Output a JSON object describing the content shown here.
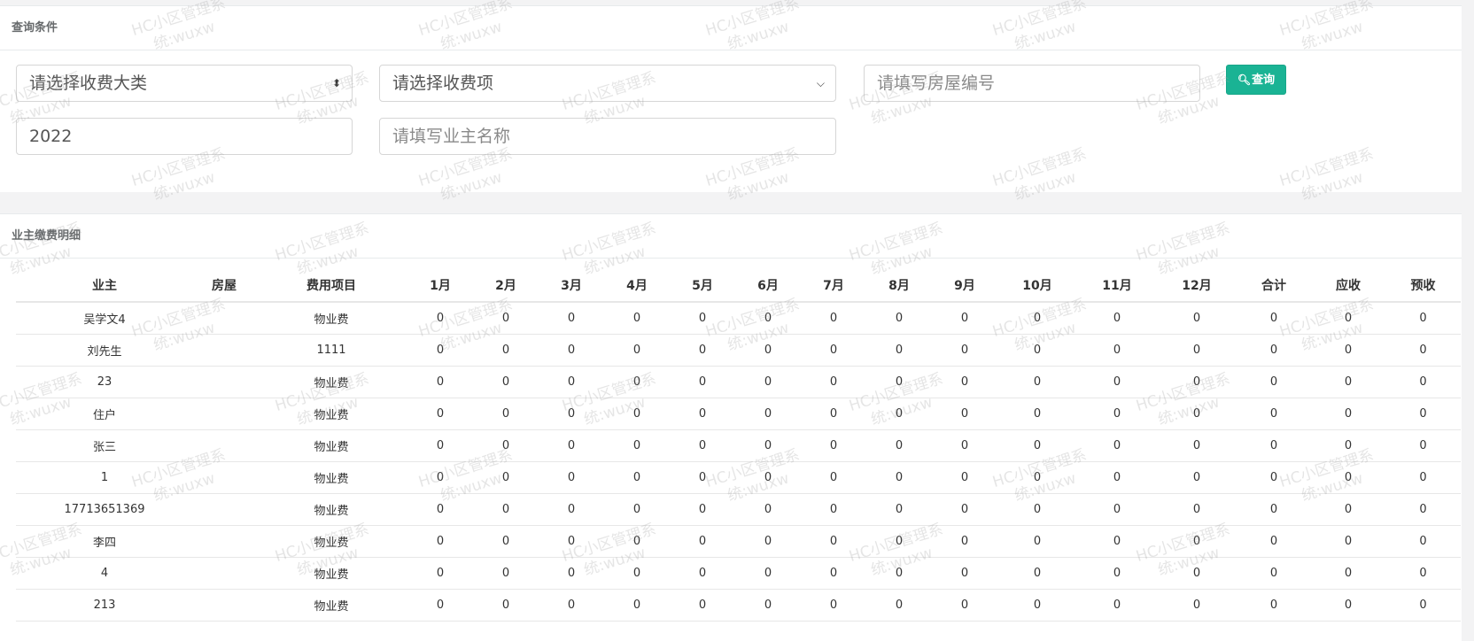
{
  "query_panel": {
    "title": "查询条件",
    "fee_category_select": "请选择收费大类",
    "fee_item_select": "请选择收费项",
    "room_input_placeholder": "请填写房屋编号",
    "year_input_value": "2022",
    "owner_input_placeholder": "请填写业主名称",
    "query_button_label": "查询"
  },
  "detail_panel": {
    "title": "业主缴费明细",
    "columns": [
      "业主",
      "房屋",
      "费用项目",
      "1月",
      "2月",
      "3月",
      "4月",
      "5月",
      "6月",
      "7月",
      "8月",
      "9月",
      "10月",
      "11月",
      "12月",
      "合计",
      "应收",
      "预收"
    ],
    "rows": [
      [
        "吴学文4",
        "",
        "物业费",
        "0",
        "0",
        "0",
        "0",
        "0",
        "0",
        "0",
        "0",
        "0",
        "0",
        "0",
        "0",
        "0",
        "0",
        "0"
      ],
      [
        "刘先生",
        "",
        "1111",
        "0",
        "0",
        "0",
        "0",
        "0",
        "0",
        "0",
        "0",
        "0",
        "0",
        "0",
        "0",
        "0",
        "0",
        "0"
      ],
      [
        "23",
        "",
        "物业费",
        "0",
        "0",
        "0",
        "0",
        "0",
        "0",
        "0",
        "0",
        "0",
        "0",
        "0",
        "0",
        "0",
        "0",
        "0"
      ],
      [
        "住户",
        "",
        "物业费",
        "0",
        "0",
        "0",
        "0",
        "0",
        "0",
        "0",
        "0",
        "0",
        "0",
        "0",
        "0",
        "0",
        "0",
        "0"
      ],
      [
        "张三",
        "",
        "物业费",
        "0",
        "0",
        "0",
        "0",
        "0",
        "0",
        "0",
        "0",
        "0",
        "0",
        "0",
        "0",
        "0",
        "0",
        "0"
      ],
      [
        "1",
        "",
        "物业费",
        "0",
        "0",
        "0",
        "0",
        "0",
        "0",
        "0",
        "0",
        "0",
        "0",
        "0",
        "0",
        "0",
        "0",
        "0"
      ],
      [
        "17713651369",
        "",
        "物业费",
        "0",
        "0",
        "0",
        "0",
        "0",
        "0",
        "0",
        "0",
        "0",
        "0",
        "0",
        "0",
        "0",
        "0",
        "0"
      ],
      [
        "李四",
        "",
        "物业费",
        "0",
        "0",
        "0",
        "0",
        "0",
        "0",
        "0",
        "0",
        "0",
        "0",
        "0",
        "0",
        "0",
        "0",
        "0"
      ],
      [
        "4",
        "",
        "物业费",
        "0",
        "0",
        "0",
        "0",
        "0",
        "0",
        "0",
        "0",
        "0",
        "0",
        "0",
        "0",
        "0",
        "0",
        "0"
      ],
      [
        "213",
        "",
        "物业费",
        "0",
        "0",
        "0",
        "0",
        "0",
        "0",
        "0",
        "0",
        "0",
        "0",
        "0",
        "0",
        "0",
        "0",
        "0"
      ]
    ]
  },
  "watermark": {
    "line1": "HC小区管理系",
    "line2": "统:wuxw"
  },
  "colors": {
    "primary_button": "#1ab394",
    "page_background": "#f3f3f4"
  },
  "icons": {
    "query_button_icon": "search-icon",
    "select_arrow": "chevron-down-icon",
    "select_updown": "sort-updown-icon"
  }
}
